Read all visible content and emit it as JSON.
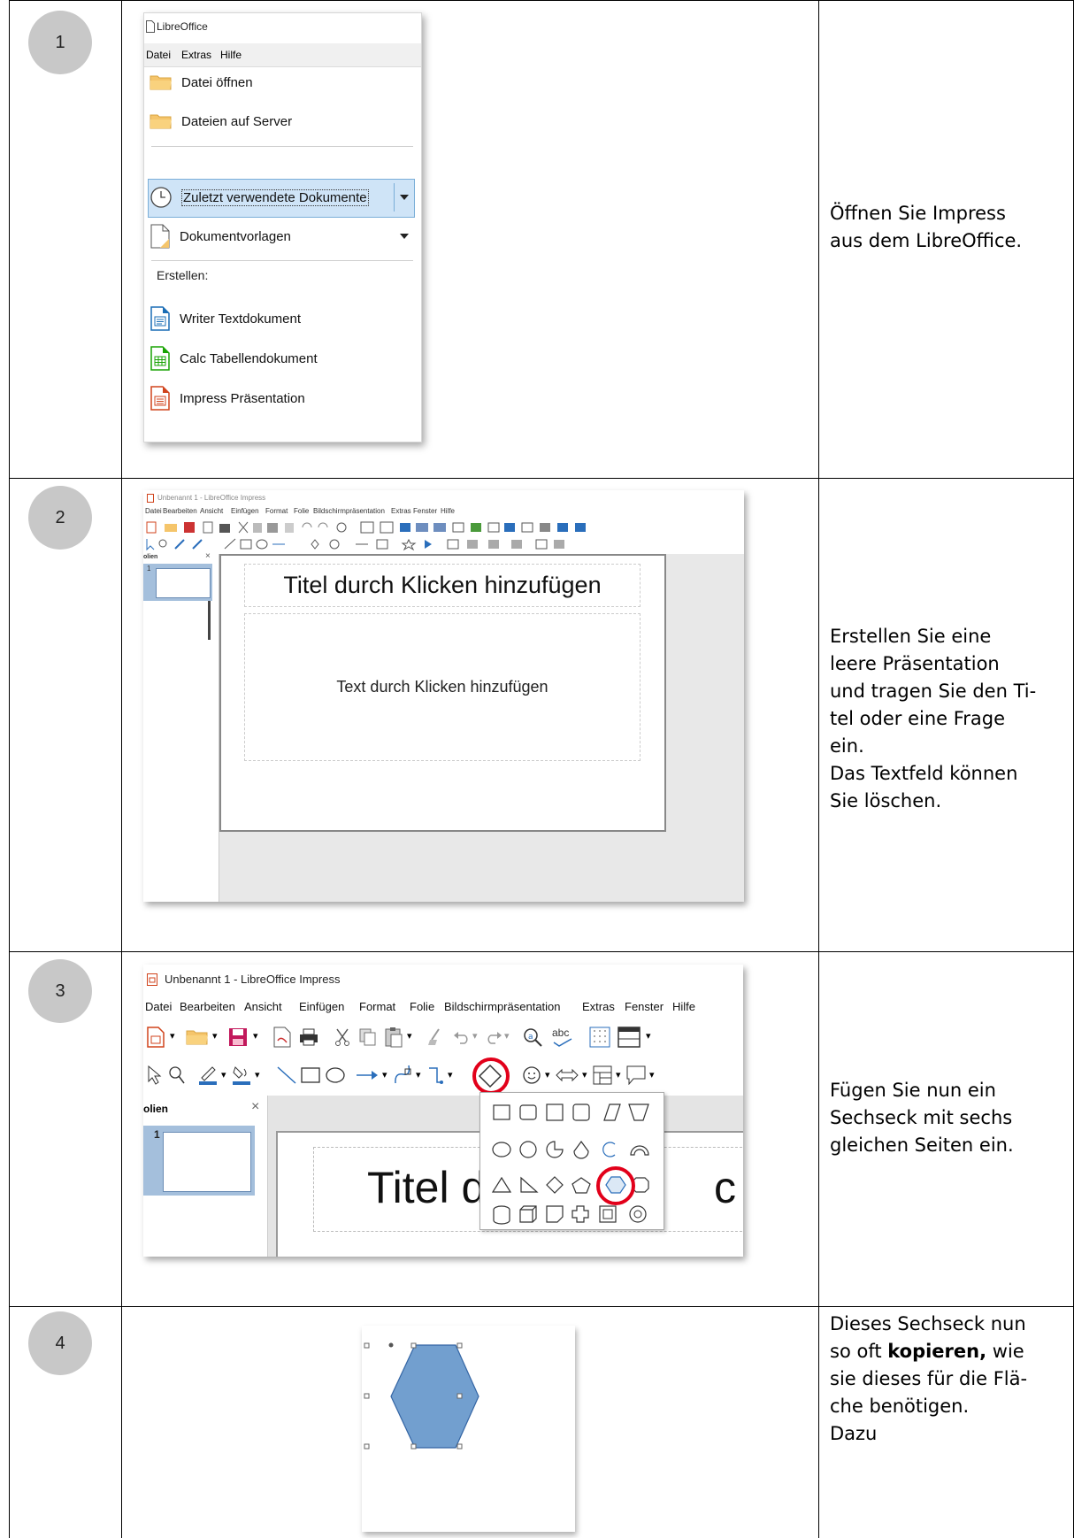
{
  "steps": [
    {
      "number": "1",
      "desc_lines": [
        "Öffnen Sie Impress",
        "aus dem LibreOffice."
      ]
    },
    {
      "number": "2",
      "desc_lines": [
        "Erstellen Sie eine",
        "leere Präsentation",
        "und tragen Sie den Ti-",
        "tel oder eine Frage",
        "ein.",
        "Das Textfeld können",
        "Sie löschen."
      ]
    },
    {
      "number": "3",
      "desc_lines": [
        "Fügen Sie nun ein",
        "Sechseck mit sechs",
        "gleichen Seiten ein."
      ]
    },
    {
      "number": "4",
      "desc_lines": [
        "Dieses Sechseck nun",
        "so oft ",
        "kopieren,",
        " wie",
        "sie dieses für die Flä-",
        "che benötigen.",
        "Dazu"
      ]
    }
  ],
  "start_center": {
    "title": "LibreOffice",
    "menu": [
      "Datei",
      "Extras",
      "Hilfe"
    ],
    "items": {
      "open_file": "Datei öffnen",
      "remote_files": "Dateien auf Server",
      "recent_docs": "Zuletzt verwendete Dokumente",
      "templates": "Dokumentvorlagen",
      "create_label": "Erstellen:",
      "writer": "Writer Textdokument",
      "calc": "Calc Tabellendokument",
      "impress": "Impress Präsentation"
    }
  },
  "impress_small": {
    "title": "Unbenannt 1 - LibreOffice Impress",
    "menu": [
      "Datei",
      "Bearbeiten",
      "Ansicht",
      "Einfügen",
      "Format",
      "Folie",
      "Bildschirmpräsentation",
      "Extras",
      "Fenster",
      "Hilfe"
    ],
    "slides_panel_label": "olien",
    "slide_number": "1",
    "title_placeholder": "Titel durch Klicken hinzufügen",
    "text_placeholder": "Text durch Klicken hinzufügen"
  },
  "impress_zoom": {
    "title": "Unbenannt 1 - LibreOffice Impress",
    "menu": [
      "Datei",
      "Bearbeiten",
      "Ansicht",
      "Einfügen",
      "Format",
      "Folie",
      "Bildschirmpräsentation",
      "Extras",
      "Fenster",
      "Hilfe"
    ],
    "slides_panel_label": "olien",
    "slide_number": "1",
    "title_fragment_left": "Titel d",
    "title_fragment_right": "c",
    "spell_label": "abc"
  },
  "colors": {
    "step_circle": "#c8c8c8",
    "highlight_ring": "#e2001a",
    "hexagon_fill": "#729fcf",
    "hexagon_stroke": "#3465a4",
    "selection_bg": "#cfe4f7"
  }
}
